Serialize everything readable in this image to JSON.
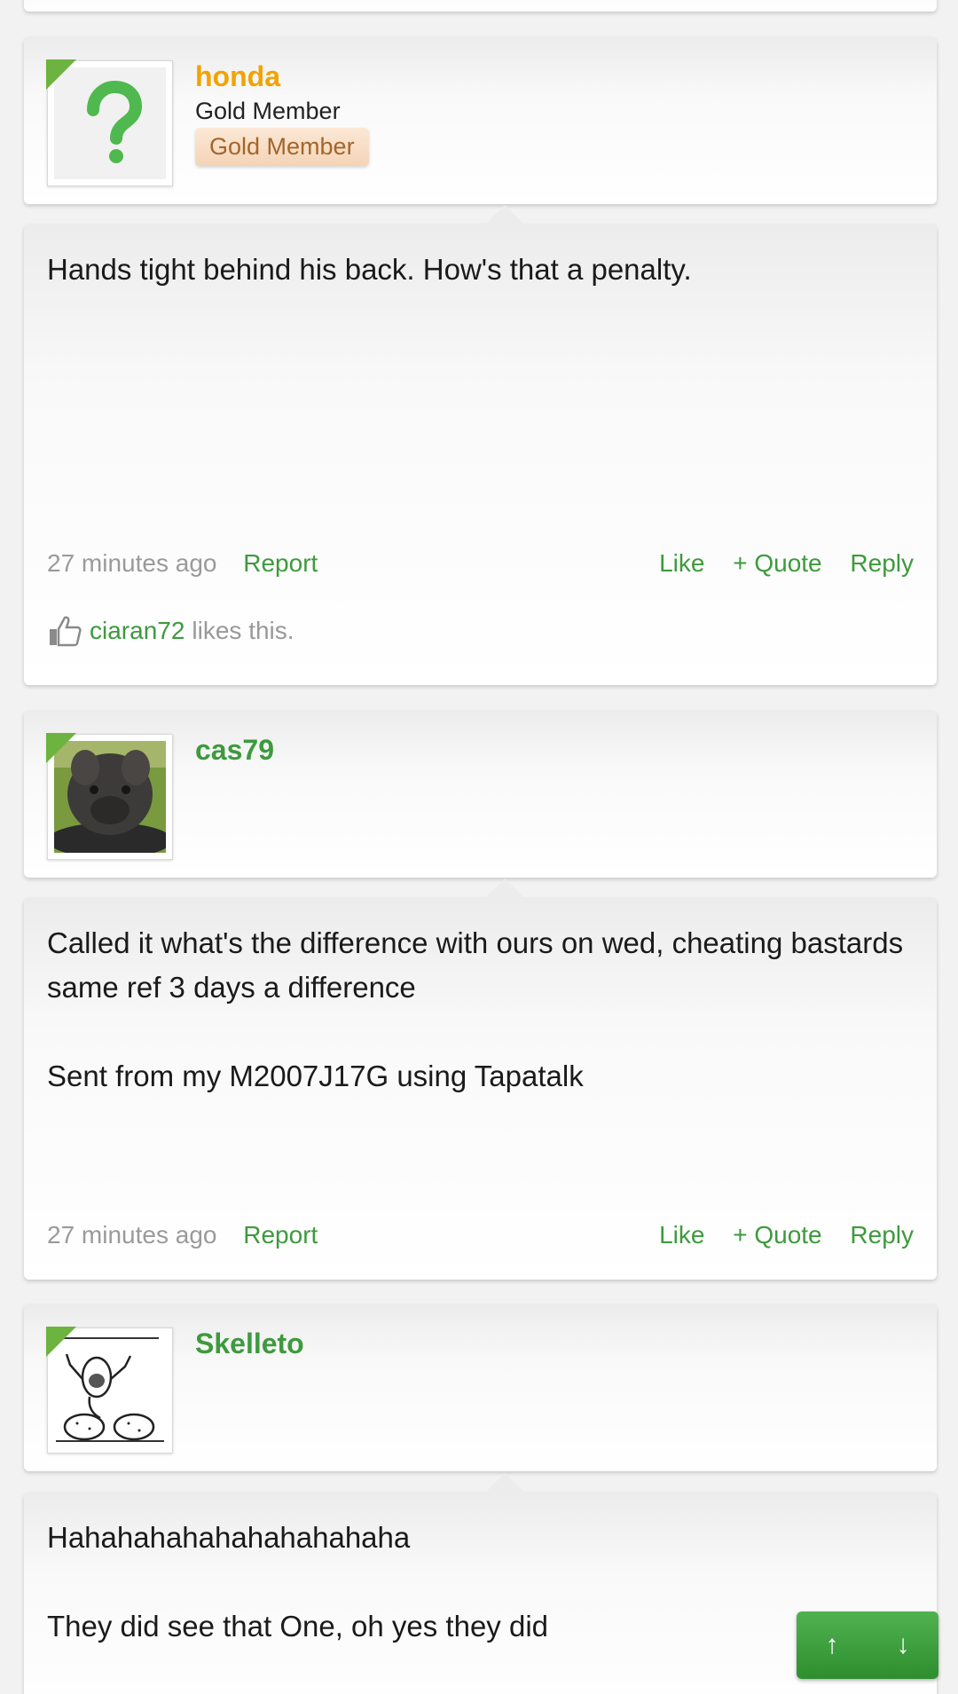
{
  "posts": [
    {
      "username": "honda",
      "username_color": "#f2a300",
      "user_title": "Gold Member",
      "user_badge": "Gold Member",
      "message": "Hands tight behind his back. How's that a penalty.",
      "time": "27 minutes ago",
      "report": "Report",
      "like": "Like",
      "quote": "+ Quote",
      "reply": "Reply",
      "liker": "ciaran72",
      "likes_suffix": "likes this."
    },
    {
      "username": "cas79",
      "username_color": "#3d9a3d",
      "message": "Called it what's the difference with ours on wed, cheating bastards same ref 3 days a difference\n\nSent from my M2007J17G using Tapatalk",
      "time": "27 minutes ago",
      "report": "Report",
      "like": "Like",
      "quote": "+ Quote",
      "reply": "Reply"
    },
    {
      "username": "Skelleto",
      "username_color": "#3d9a3d",
      "message": "Hahahahahahahahahahaha\n\nThey did see that One, oh yes they did"
    }
  ],
  "scroll_buttons": {
    "up": "↑",
    "down": "↓"
  },
  "accent_green": "#3d9a3d"
}
